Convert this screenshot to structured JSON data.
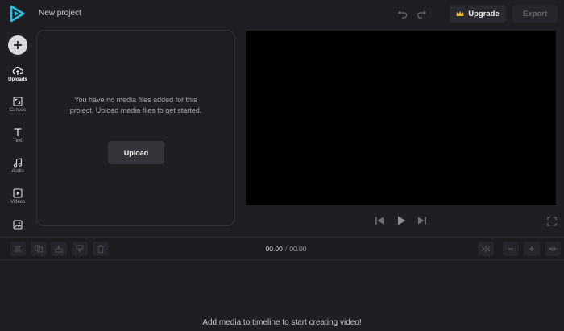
{
  "header": {
    "project_title": "New project",
    "upgrade_label": "Upgrade",
    "export_label": "Export",
    "crown_icon_color": "#f3b92a",
    "logo_color": "#27c3e8"
  },
  "sidebar": {
    "items": [
      {
        "label": "Uploads",
        "icon": "upload-cloud-icon"
      },
      {
        "label": "Canvas",
        "icon": "canvas-icon"
      },
      {
        "label": "Text",
        "icon": "text-icon"
      },
      {
        "label": "Audio",
        "icon": "music-note-icon"
      },
      {
        "label": "Videos",
        "icon": "video-play-icon"
      },
      {
        "label": "",
        "icon": "image-icon"
      }
    ]
  },
  "media_panel": {
    "empty_message": "You have no media files added for this project. Upload media files to get started.",
    "upload_label": "Upload"
  },
  "timeline": {
    "current_time": "00.00",
    "separator": "/",
    "total_time": "00.00",
    "empty_hint": "Add media to timeline to start creating video!"
  }
}
